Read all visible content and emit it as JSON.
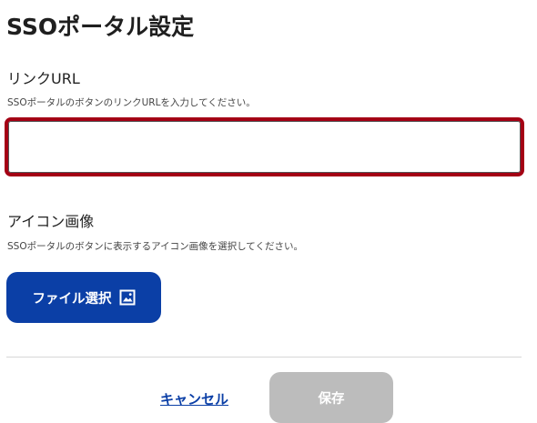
{
  "page": {
    "title": "SSOポータル設定"
  },
  "link_url": {
    "label": "リンクURL",
    "help": "SSOポータルのボタンのリンクURLを入力してください。",
    "value": "",
    "placeholder": ""
  },
  "icon_image": {
    "label": "アイコン画像",
    "help": "SSOポータルのボタンに表示するアイコン画像を選択してください。",
    "button_label": "ファイル選択",
    "button_icon": "image-icon"
  },
  "actions": {
    "cancel_label": "キャンセル",
    "save_label": "保存"
  },
  "colors": {
    "primary": "#0b3fa6",
    "input_error_border": "#a40014",
    "disabled_button": "#bcbcbc"
  }
}
